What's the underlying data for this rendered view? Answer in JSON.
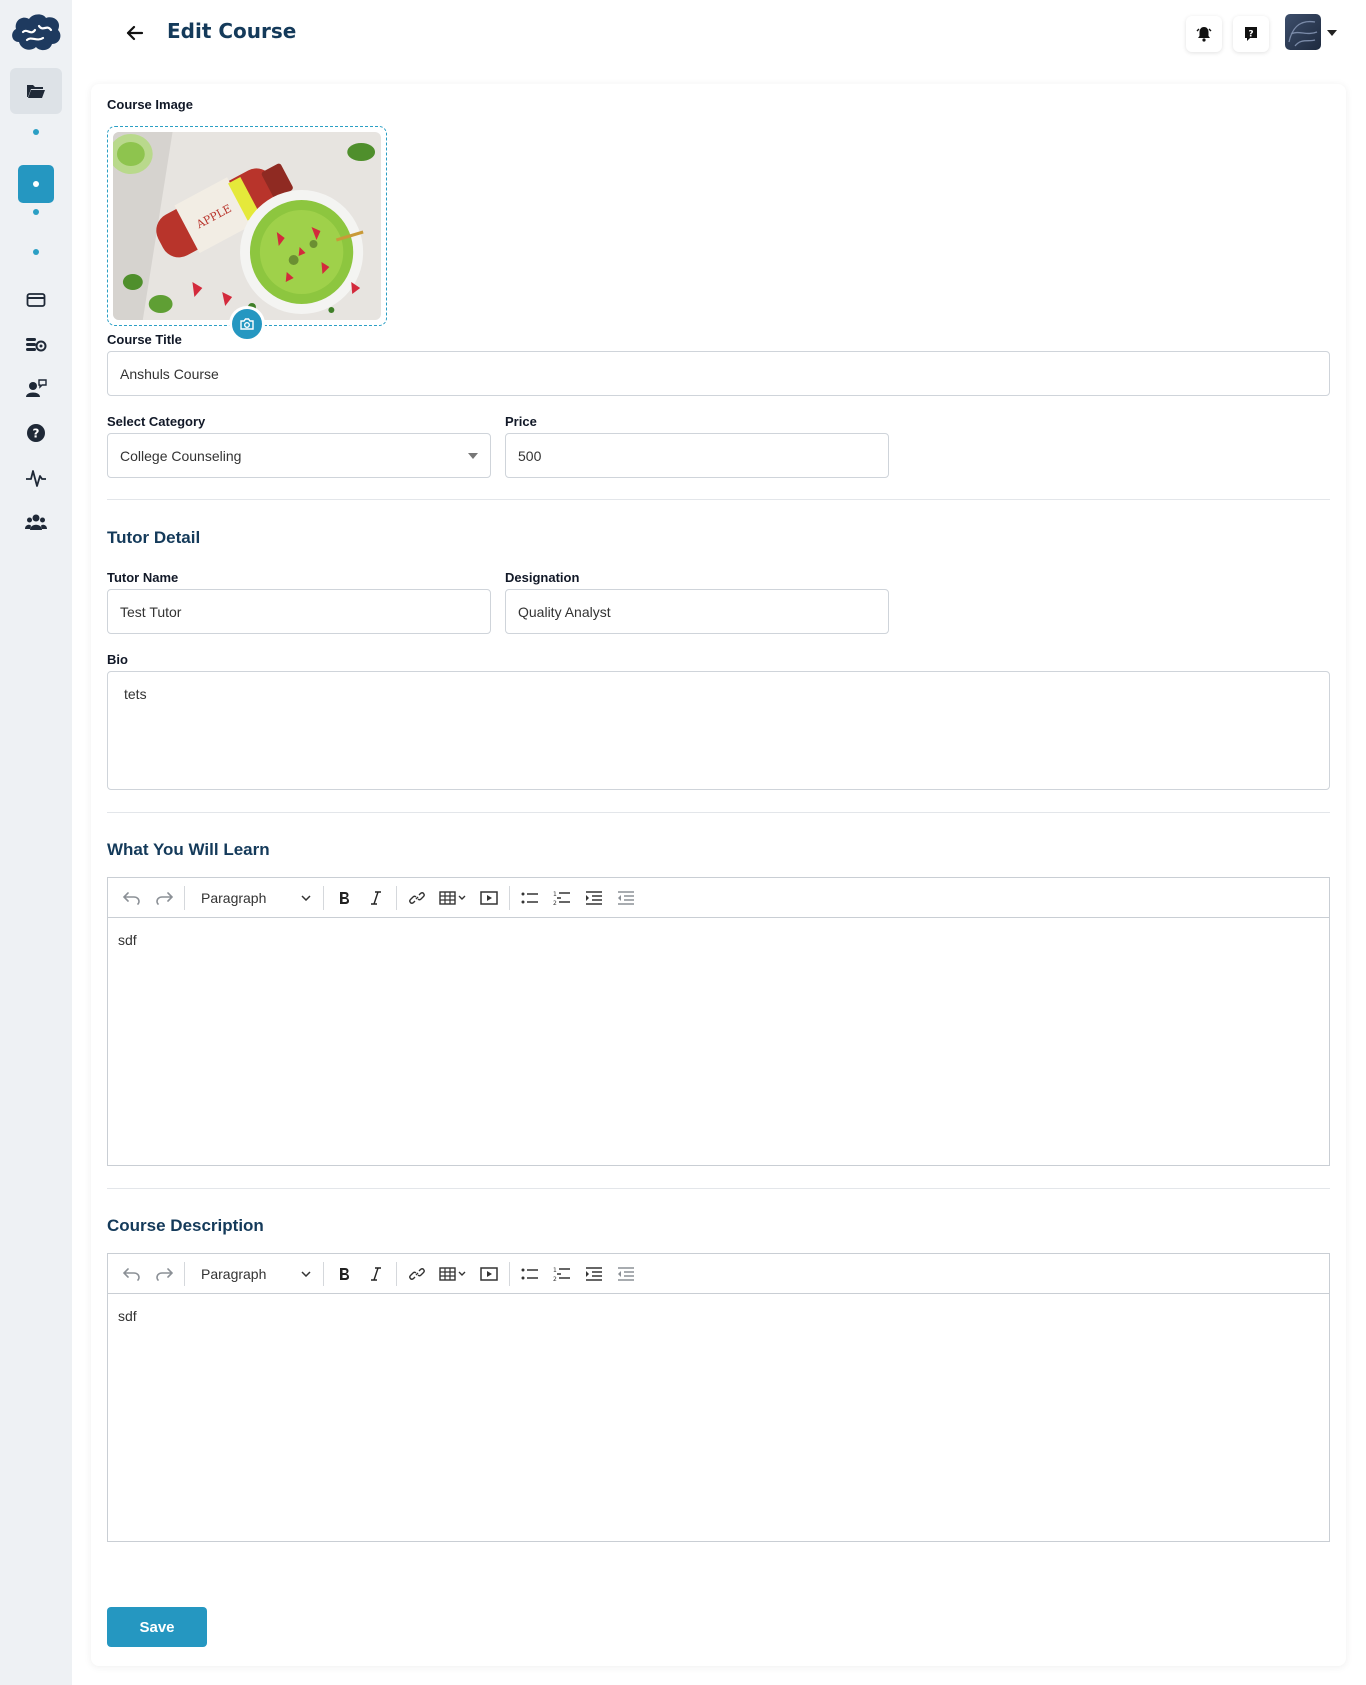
{
  "header": {
    "title": "Edit Course"
  },
  "form": {
    "course_image_label": "Course Image",
    "course_title_label": "Course Title",
    "course_title_value": "Anshuls Course",
    "category_label": "Select Category",
    "category_value": "College Counseling",
    "price_label": "Price",
    "price_value": "500"
  },
  "tutor": {
    "section_title": "Tutor Detail",
    "name_label": "Tutor Name",
    "name_value": "Test Tutor",
    "designation_label": "Designation",
    "designation_value": "Quality Analyst",
    "bio_label": "Bio",
    "bio_value": "tets"
  },
  "learn": {
    "section_title": "What You Will Learn",
    "paragraph_label": "Paragraph",
    "content": "sdf"
  },
  "description": {
    "section_title": "Course Description",
    "paragraph_label": "Paragraph",
    "content": "sdf"
  },
  "actions": {
    "save_label": "Save"
  },
  "colors": {
    "accent": "#2597c1",
    "title": "#143a5a"
  }
}
